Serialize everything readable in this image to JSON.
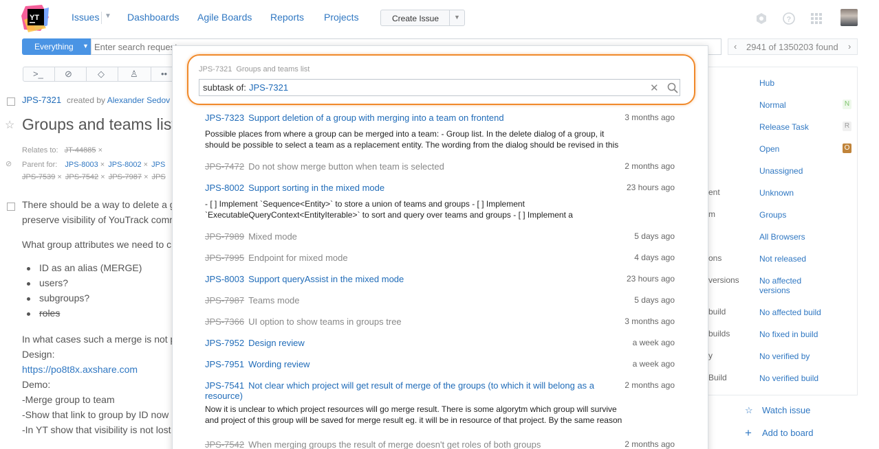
{
  "header": {
    "nav": [
      "Issues",
      "Dashboards",
      "Agile Boards",
      "Reports",
      "Projects"
    ],
    "create_label": "Create Issue"
  },
  "search": {
    "scope": "Everything",
    "placeholder": "Enter search request",
    "found": "2941 of 1350203 found"
  },
  "issue": {
    "id": "JPS-7321",
    "created_by_prefix": "created by",
    "author": "Alexander Sedov",
    "title": "Groups and teams list",
    "relates_label": "Relates to:",
    "relates": "JT-44885",
    "parent_label": "Parent for:",
    "parents_row1": [
      "JPS-8003",
      "JPS-8002",
      "JPS"
    ],
    "parents_row2": [
      "JPS-7539",
      "JPS-7542",
      "JPS-7987",
      "JPS"
    ],
    "desc1": "There should be a way to delete a g",
    "desc2": "preserve visibility of YouTrack comm",
    "desc3": "What group attributes we need to c",
    "bullets": [
      "ID as an alias (MERGE)",
      "users?",
      "subgroups?",
      "roles"
    ],
    "desc4": "In what cases such a merge is not p",
    "design_label": "Design:",
    "design_link": "https://po8t8x.axshare.com",
    "demo_label": "Demo:",
    "demo1": "-Merge group to team",
    "demo2": "-Show that link to group by ID now",
    "demo3": "-In YT show that visibility is not lost"
  },
  "fields": {
    "labels": [
      "ent",
      "m",
      "ons",
      "versions",
      "build",
      "builds",
      "y",
      "Build"
    ],
    "values": [
      "Hub",
      "Normal",
      "Release Task",
      "Open",
      "Unassigned",
      "Unknown",
      "Groups",
      "All Browsers",
      "Not released",
      "No affected versions",
      "No affected build",
      "No fixed in build",
      "No verified by",
      "No verified build"
    ],
    "badges": [
      "N",
      "R",
      "O"
    ],
    "badge_colors": [
      "#7cc36a",
      "#9a9a9a",
      "#c0843a"
    ],
    "watch": "Watch issue",
    "add_board": "Add to board"
  },
  "popup": {
    "crumb_id": "JPS-7321",
    "crumb_title": "Groups and teams list",
    "query_key": "subtask of:",
    "query_value": "JPS-7321",
    "items": [
      {
        "id": "JPS-7323",
        "summary": "Support deletion of a group with merging into a team on frontend",
        "when": "3 months ago",
        "resolved": false,
        "desc1": "Possible places from where a group can be merged into a team: - Group list. In the delete dialog of a group, it",
        "desc2": "should be possible to select a team as a replacement entity. The wording from the dialog should be revised in this"
      },
      {
        "id": "JPS-7472",
        "summary": "Do not show merge button when team is selected",
        "when": "2 months ago",
        "resolved": true
      },
      {
        "id": "JPS-8002",
        "summary": "Support sorting in the mixed mode",
        "when": "23 hours ago",
        "resolved": false,
        "desc1": "- [ ] Implement `Sequence<Entity>` to store a union of teams and groups - [ ] Implement",
        "desc2": "`ExecutableQueryContext<EntityIterable>` to sort and query over teams and groups - [ ] Implement a"
      },
      {
        "id": "JPS-7989",
        "summary": "Mixed mode",
        "when": "5 days ago",
        "resolved": true
      },
      {
        "id": "JPS-7995",
        "summary": "Endpoint for mixed mode",
        "when": "4 days ago",
        "resolved": true
      },
      {
        "id": "JPS-8003",
        "summary": "Support queryAssist in the mixed mode",
        "when": "23 hours ago",
        "resolved": false
      },
      {
        "id": "JPS-7987",
        "summary": "Teams mode",
        "when": "5 days ago",
        "resolved": true
      },
      {
        "id": "JPS-7366",
        "summary": "UI option to show teams in groups tree",
        "when": "3 months ago",
        "resolved": true
      },
      {
        "id": "JPS-7952",
        "summary": "Design review",
        "when": "a week ago",
        "resolved": false
      },
      {
        "id": "JPS-7951",
        "summary": "Wording review",
        "when": "a week ago",
        "resolved": false
      },
      {
        "id": "JPS-7541",
        "summary": "Not clear which project will get result of merge of the groups (to which it will belong as a resource)",
        "when": "2 months ago",
        "resolved": false,
        "desc1": "Now it is unclear to which project resources will go merge result. There is some algorytm which group will survive",
        "desc2": "and project of this group will be saved for merge result eg. it will be in resource of that project. By the same reason"
      },
      {
        "id": "JPS-7542",
        "summary": "When merging groups the result of merge doesn't get roles of both groups",
        "when": "2 months ago",
        "resolved": true
      }
    ]
  }
}
